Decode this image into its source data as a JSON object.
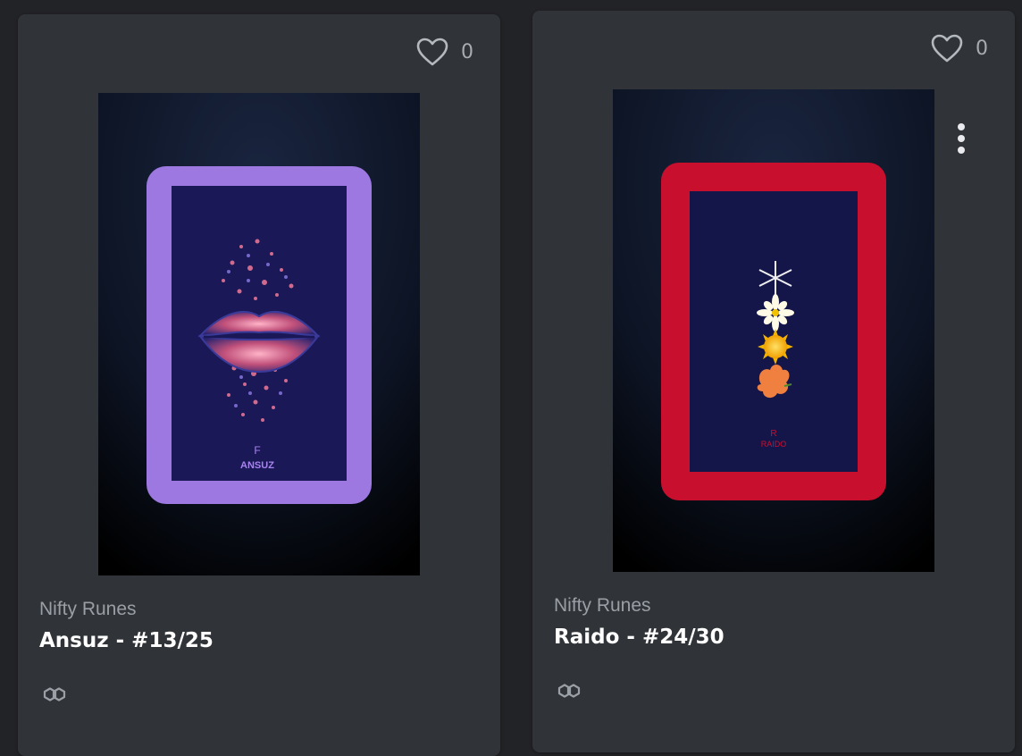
{
  "cards": [
    {
      "likes": "0",
      "collection": "Nifty Runes",
      "title": "Ansuz - #13/25",
      "rune_glyph": "F",
      "rune_name": "ANSUZ",
      "frame_color": "#9c78e0",
      "chain_icon": "polygon-icon"
    },
    {
      "likes": "0",
      "collection": "Nifty Runes",
      "title": "Raido - #24/30",
      "rune_glyph": "R",
      "rune_name": "RAIDO",
      "frame_color": "#c8102e",
      "chain_icon": "polygon-icon",
      "has_menu": true
    }
  ]
}
